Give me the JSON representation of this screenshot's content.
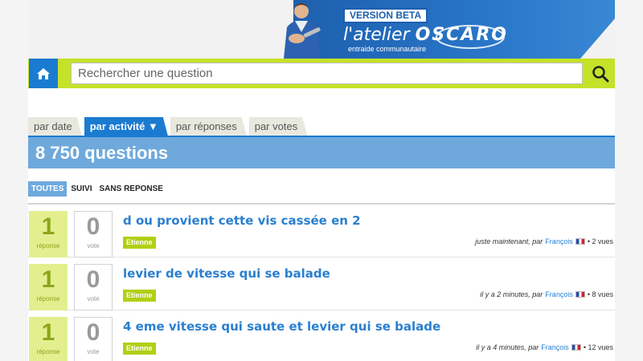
{
  "banner": {
    "beta": "VERSION BETA",
    "brand_prefix": "l'atelier",
    "brand_name": "OSCARO",
    "tagline": "entraide communautaire"
  },
  "search": {
    "placeholder": "Rechercher une question"
  },
  "tabs": [
    {
      "label": "par date",
      "active": false
    },
    {
      "label": "par activité ▼",
      "active": true
    },
    {
      "label": "par réponses",
      "active": false
    },
    {
      "label": "par votes",
      "active": false
    }
  ],
  "questions_count": "8 750 questions",
  "filters": [
    {
      "label": "TOUTES",
      "active": true
    },
    {
      "label": "SUIVI",
      "active": false
    },
    {
      "label": "SANS REPONSE",
      "active": false
    }
  ],
  "questions": [
    {
      "answers": "1",
      "answers_label": "réponse",
      "votes": "0",
      "votes_label": "vote",
      "title": "d ou provient cette vis cassée en 2",
      "tag": "Etienne",
      "time": "juste maintenant, par",
      "author": "François",
      "views": "• 2 vues"
    },
    {
      "answers": "1",
      "answers_label": "réponse",
      "votes": "0",
      "votes_label": "vote",
      "title": "levier de vitesse qui se balade",
      "tag": "Etienne",
      "time": "il y a 2 minutes, par",
      "author": "François",
      "views": "• 8 vues"
    },
    {
      "answers": "1",
      "answers_label": "réponse",
      "votes": "0",
      "votes_label": "vote",
      "title": "4 eme vitesse qui saute et levier qui se balade",
      "tag": "Etienne",
      "time": "il y a 4 minutes, par",
      "author": "François",
      "views": "• 12 vues"
    }
  ],
  "colors": {
    "brand_blue": "#1b7bd1",
    "accent_green": "#c5e228",
    "count_bar": "#6fa9dc"
  },
  "icons": {
    "home": "home-icon",
    "search": "search-icon",
    "flag": "flag-fr-icon"
  }
}
